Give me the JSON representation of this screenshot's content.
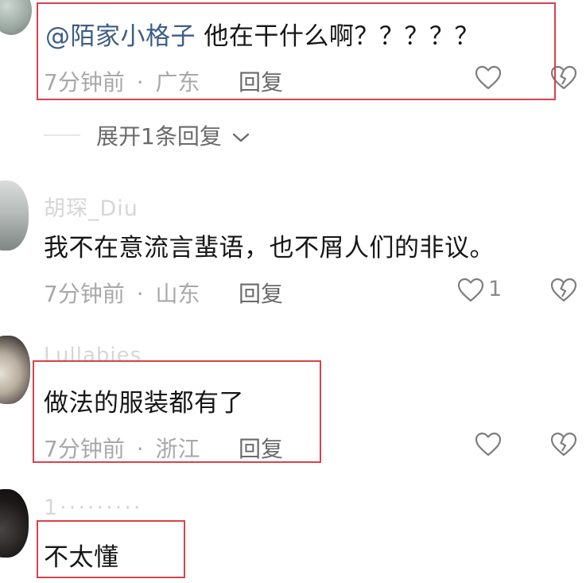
{
  "comments": [
    {
      "mention": "@陌家小格子",
      "text": "他在干什么啊？？？？？",
      "time": "7分钟前",
      "separator": "·",
      "location": "广东",
      "reply_label": "回复"
    },
    {
      "username": "胡琛_Diu",
      "text": "我不在意流言蜚语，也不屑人们的非议。",
      "time": "7分钟前",
      "separator": "·",
      "location": "山东",
      "reply_label": "回复",
      "like_count": "1"
    },
    {
      "username": "Lullabies",
      "text": "做法的服装都有了",
      "time": "7分钟前",
      "separator": "·",
      "location": "浙江",
      "reply_label": "回复"
    },
    {
      "username": "1·········",
      "text": "不太懂"
    }
  ],
  "expand_replies": {
    "label": "展开1条回复"
  },
  "icons": {
    "like": "heart-outline-icon",
    "dislike": "broken-heart-icon",
    "chevron": "chevron-down-icon"
  },
  "colors": {
    "highlight_box": "#d9414a",
    "mention": "#3d5d86",
    "meta": "#a8a8a8"
  }
}
